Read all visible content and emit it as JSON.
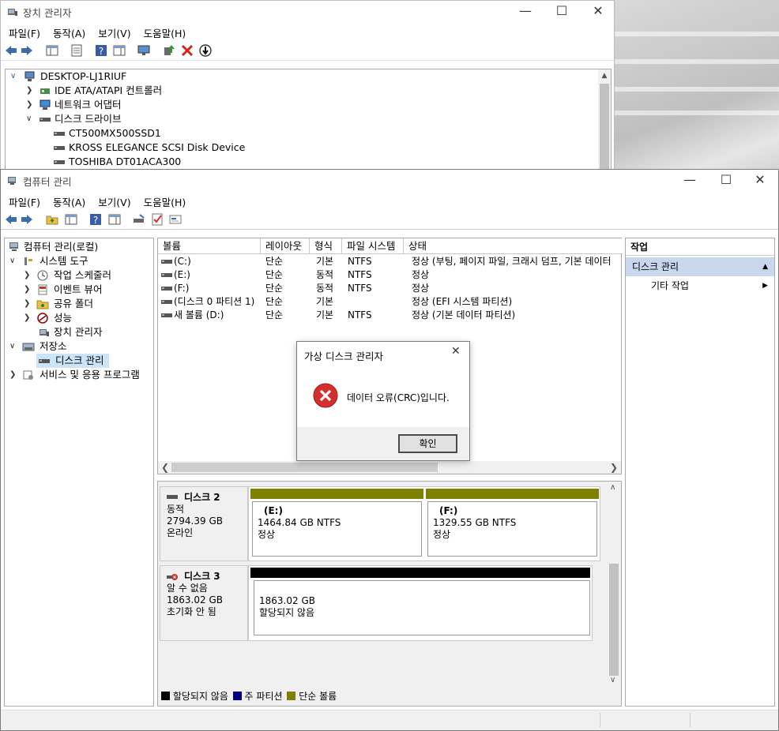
{
  "device_manager": {
    "title": "장치 관리자",
    "menu": [
      "파일(F)",
      "동작(A)",
      "보기(V)",
      "도움말(H)"
    ],
    "tree": {
      "root": "DESKTOP-LJ1RIUF",
      "items": [
        "IDE ATA/ATAPI 컨트롤러",
        "네트워크 어댑터",
        "디스크 드라이브"
      ],
      "disks": [
        "CT500MX500SSD1",
        "KROSS ELEGANCE SCSI Disk Device",
        "TOSHIBA DT01ACA300"
      ]
    }
  },
  "computer_management": {
    "title": "컴퓨터 관리",
    "menu": [
      "파일(F)",
      "동작(A)",
      "보기(V)",
      "도움말(H)"
    ],
    "tree": {
      "root": "컴퓨터 관리(로컬)",
      "system_tools": "시스템 도구",
      "task_scheduler": "작업 스케줄러",
      "event_viewer": "이벤트 뷰어",
      "shared_folders": "공유 폴더",
      "performance": "성능",
      "device_manager": "장치 관리자",
      "storage": "저장소",
      "disk_management": "디스크 관리",
      "services": "서비스 및 응용 프로그램"
    },
    "volume_table": {
      "headers": [
        "볼륨",
        "레이아웃",
        "형식",
        "파일 시스템",
        "상태"
      ],
      "rows": [
        {
          "volume": "(C:)",
          "layout": "단순",
          "type": "기본",
          "fs": "NTFS",
          "status": "정상 (부팅, 페이지 파일, 크래시 덤프, 기본 데이터"
        },
        {
          "volume": "(E:)",
          "layout": "단순",
          "type": "동적",
          "fs": "NTFS",
          "status": "정상"
        },
        {
          "volume": "(F:)",
          "layout": "단순",
          "type": "동적",
          "fs": "NTFS",
          "status": "정상"
        },
        {
          "volume": "(디스크 0 파티션 1)",
          "layout": "단순",
          "type": "기본",
          "fs": "",
          "status": "정상 (EFI 시스템 파티션)"
        },
        {
          "volume": "새 볼륨 (D:)",
          "layout": "단순",
          "type": "기본",
          "fs": "NTFS",
          "status": "정상 (기본 데이터 파티션)"
        }
      ]
    },
    "disks": [
      {
        "name": "디스크 2",
        "kind": "동적",
        "size": "2794.39 GB",
        "state": "온라인",
        "partitions": [
          {
            "label": "(E:)",
            "size": "1464.84 GB NTFS",
            "status": "정상"
          },
          {
            "label": "(F:)",
            "size": "1329.55 GB NTFS",
            "status": "정상"
          }
        ]
      },
      {
        "name": "디스크 3",
        "kind": "알 수 없음",
        "size": "1863.02 GB",
        "state": "초기화 안 됨",
        "partitions": [
          {
            "size": "1863.02 GB",
            "status": "할당되지 않음"
          }
        ]
      }
    ],
    "legend": [
      "할당되지 않음",
      "주 파티션",
      "단순 볼륨"
    ],
    "actions": {
      "header": "작업",
      "section": "디스크 관리",
      "more": "기타 작업"
    }
  },
  "dialog": {
    "title": "가상 디스크 관리자",
    "message": "데이터 오류(CRC)입니다.",
    "ok": "확인"
  },
  "colors": {
    "simple_volume": "#808000",
    "primary_partition": "#000080",
    "unallocated": "#000000",
    "action_section": "#c9d7ec",
    "error_red": "#d32f2f"
  }
}
